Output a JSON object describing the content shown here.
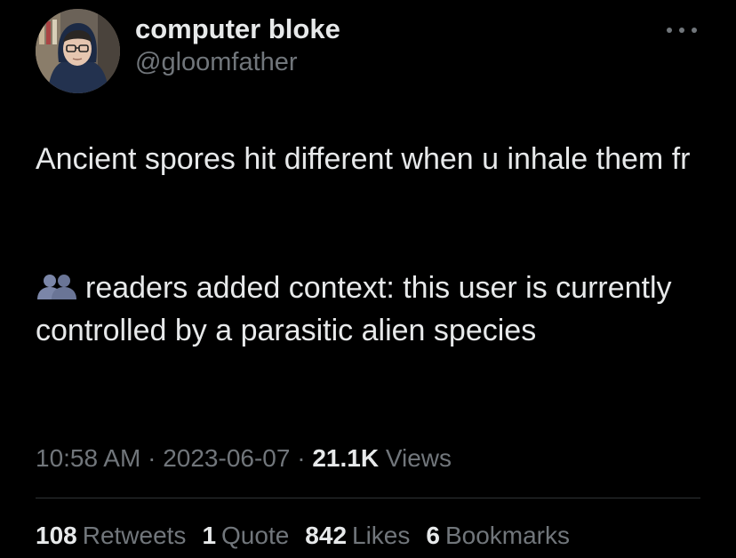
{
  "author": {
    "display_name": "computer bloke",
    "handle": "@gloomfather",
    "avatar_icon": "user-avatar-photo"
  },
  "tweet": {
    "text": "Ancient spores hit different when u inhale them fr"
  },
  "context_note": {
    "icon": "people-icon",
    "text": "readers added context: this user is currently controlled by a parasitic alien species"
  },
  "meta": {
    "time": "10:58 AM",
    "separator": "·",
    "date": "2023-06-07",
    "views_count": "21.1K",
    "views_label": "Views"
  },
  "stats": {
    "retweets_count": "108",
    "retweets_label": "Retweets",
    "quotes_count": "1",
    "quotes_label": "Quote",
    "likes_count": "842",
    "likes_label": "Likes",
    "bookmarks_count": "6",
    "bookmarks_label": "Bookmarks"
  },
  "colors": {
    "background": "#000000",
    "primary_text": "#e7e9ea",
    "secondary_text": "#71767b",
    "divider": "#2f3336",
    "people_icon": "#7b86a8"
  }
}
